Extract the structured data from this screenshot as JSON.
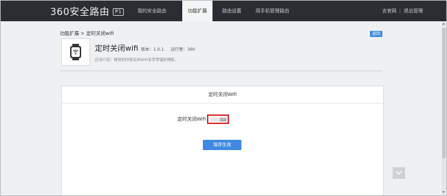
{
  "header": {
    "logo_text": "360安全路由",
    "logo_badge": "P1",
    "nav": [
      {
        "label": "我的安全路由",
        "active": false
      },
      {
        "label": "功能扩展",
        "active": true
      },
      {
        "label": "路由设置",
        "active": false
      },
      {
        "label": "用手机管理路由",
        "active": false
      }
    ],
    "official_site": "去官网",
    "separator": "|",
    "logout": "退出管理"
  },
  "breadcrumb": {
    "parent": "功能扩展",
    "separator": ">",
    "current": "定时关闭wifi"
  },
  "back_button": "返回",
  "app": {
    "icon": "watch-wifi-icon",
    "title": "定时关闭wifi",
    "version_label": "版本：1.0.1",
    "runtime_label": "运行者：360",
    "description": "应用介绍：睡觉的时候关闭WiFi享受零辐射睡眠。"
  },
  "panel": {
    "title": "定时关闭Wifi",
    "field_label": "定时关闭Wifi",
    "toggle_state": "OFF",
    "save_button": "保存生效"
  },
  "colors": {
    "topbar": "#2a2d32",
    "accent": "#3f8ae0",
    "highlight_border": "#d9262a"
  }
}
